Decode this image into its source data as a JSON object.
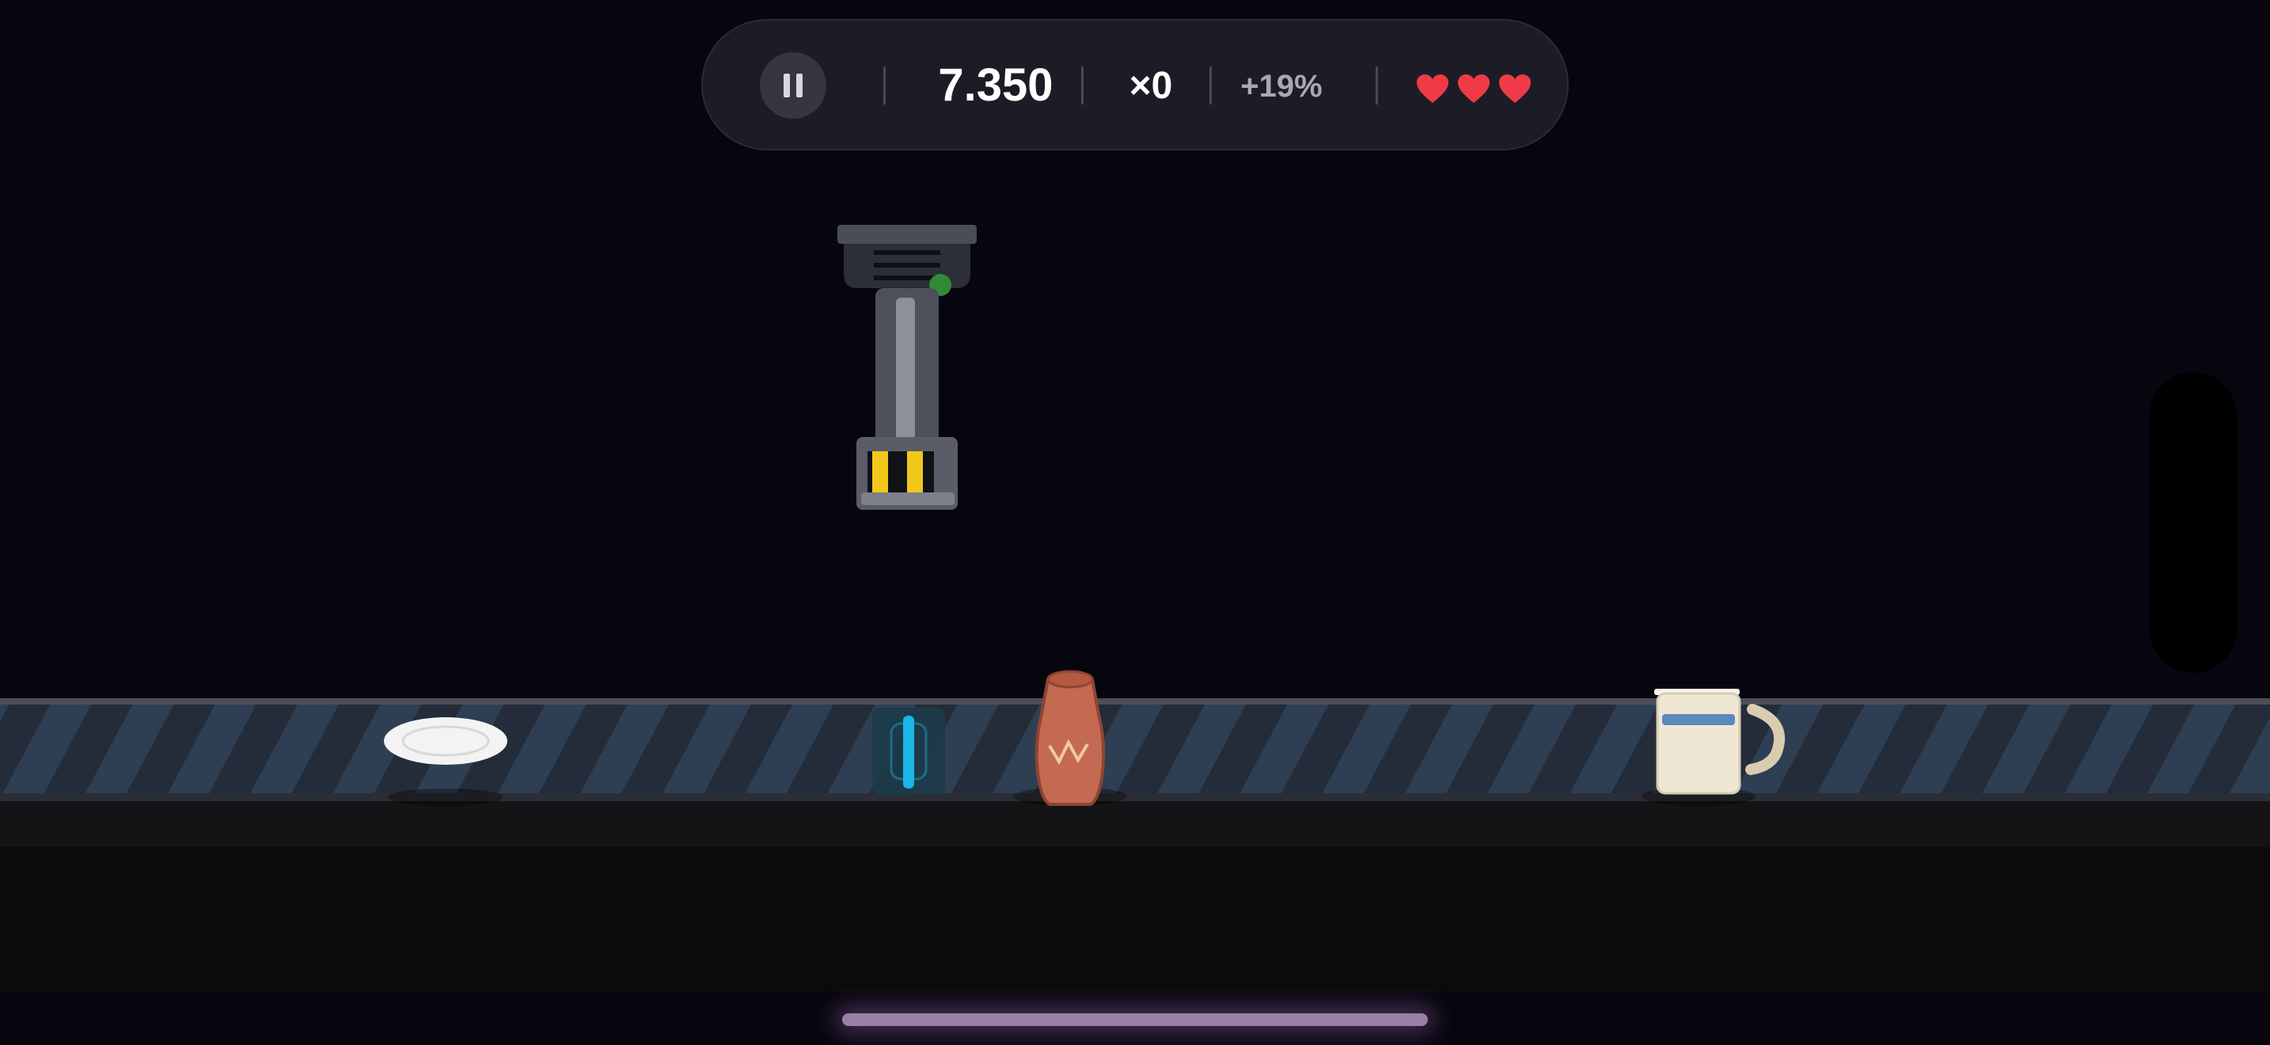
{
  "hud": {
    "score": "7.350",
    "combo": "×0",
    "bonus": "+19%",
    "lives": 3,
    "pause_icon": "pause-icon",
    "heart_icon": "heart-icon",
    "heart_color": "#ef3b48"
  },
  "belt_items": [
    {
      "name": "plate",
      "icon": "plate-icon"
    },
    {
      "name": "battery-cell",
      "icon": "battery-icon",
      "accent": "#19b6e6"
    },
    {
      "name": "clay-vase",
      "icon": "vase-icon",
      "color": "#c56a52"
    },
    {
      "name": "mug",
      "icon": "mug-icon",
      "stripe": "#5b88bd"
    }
  ],
  "colors": {
    "background": "#07060f",
    "hud_background": "#1d1c26",
    "hazard_yellow": "#f2c81a",
    "indicator_green": "#2f8a3a"
  }
}
